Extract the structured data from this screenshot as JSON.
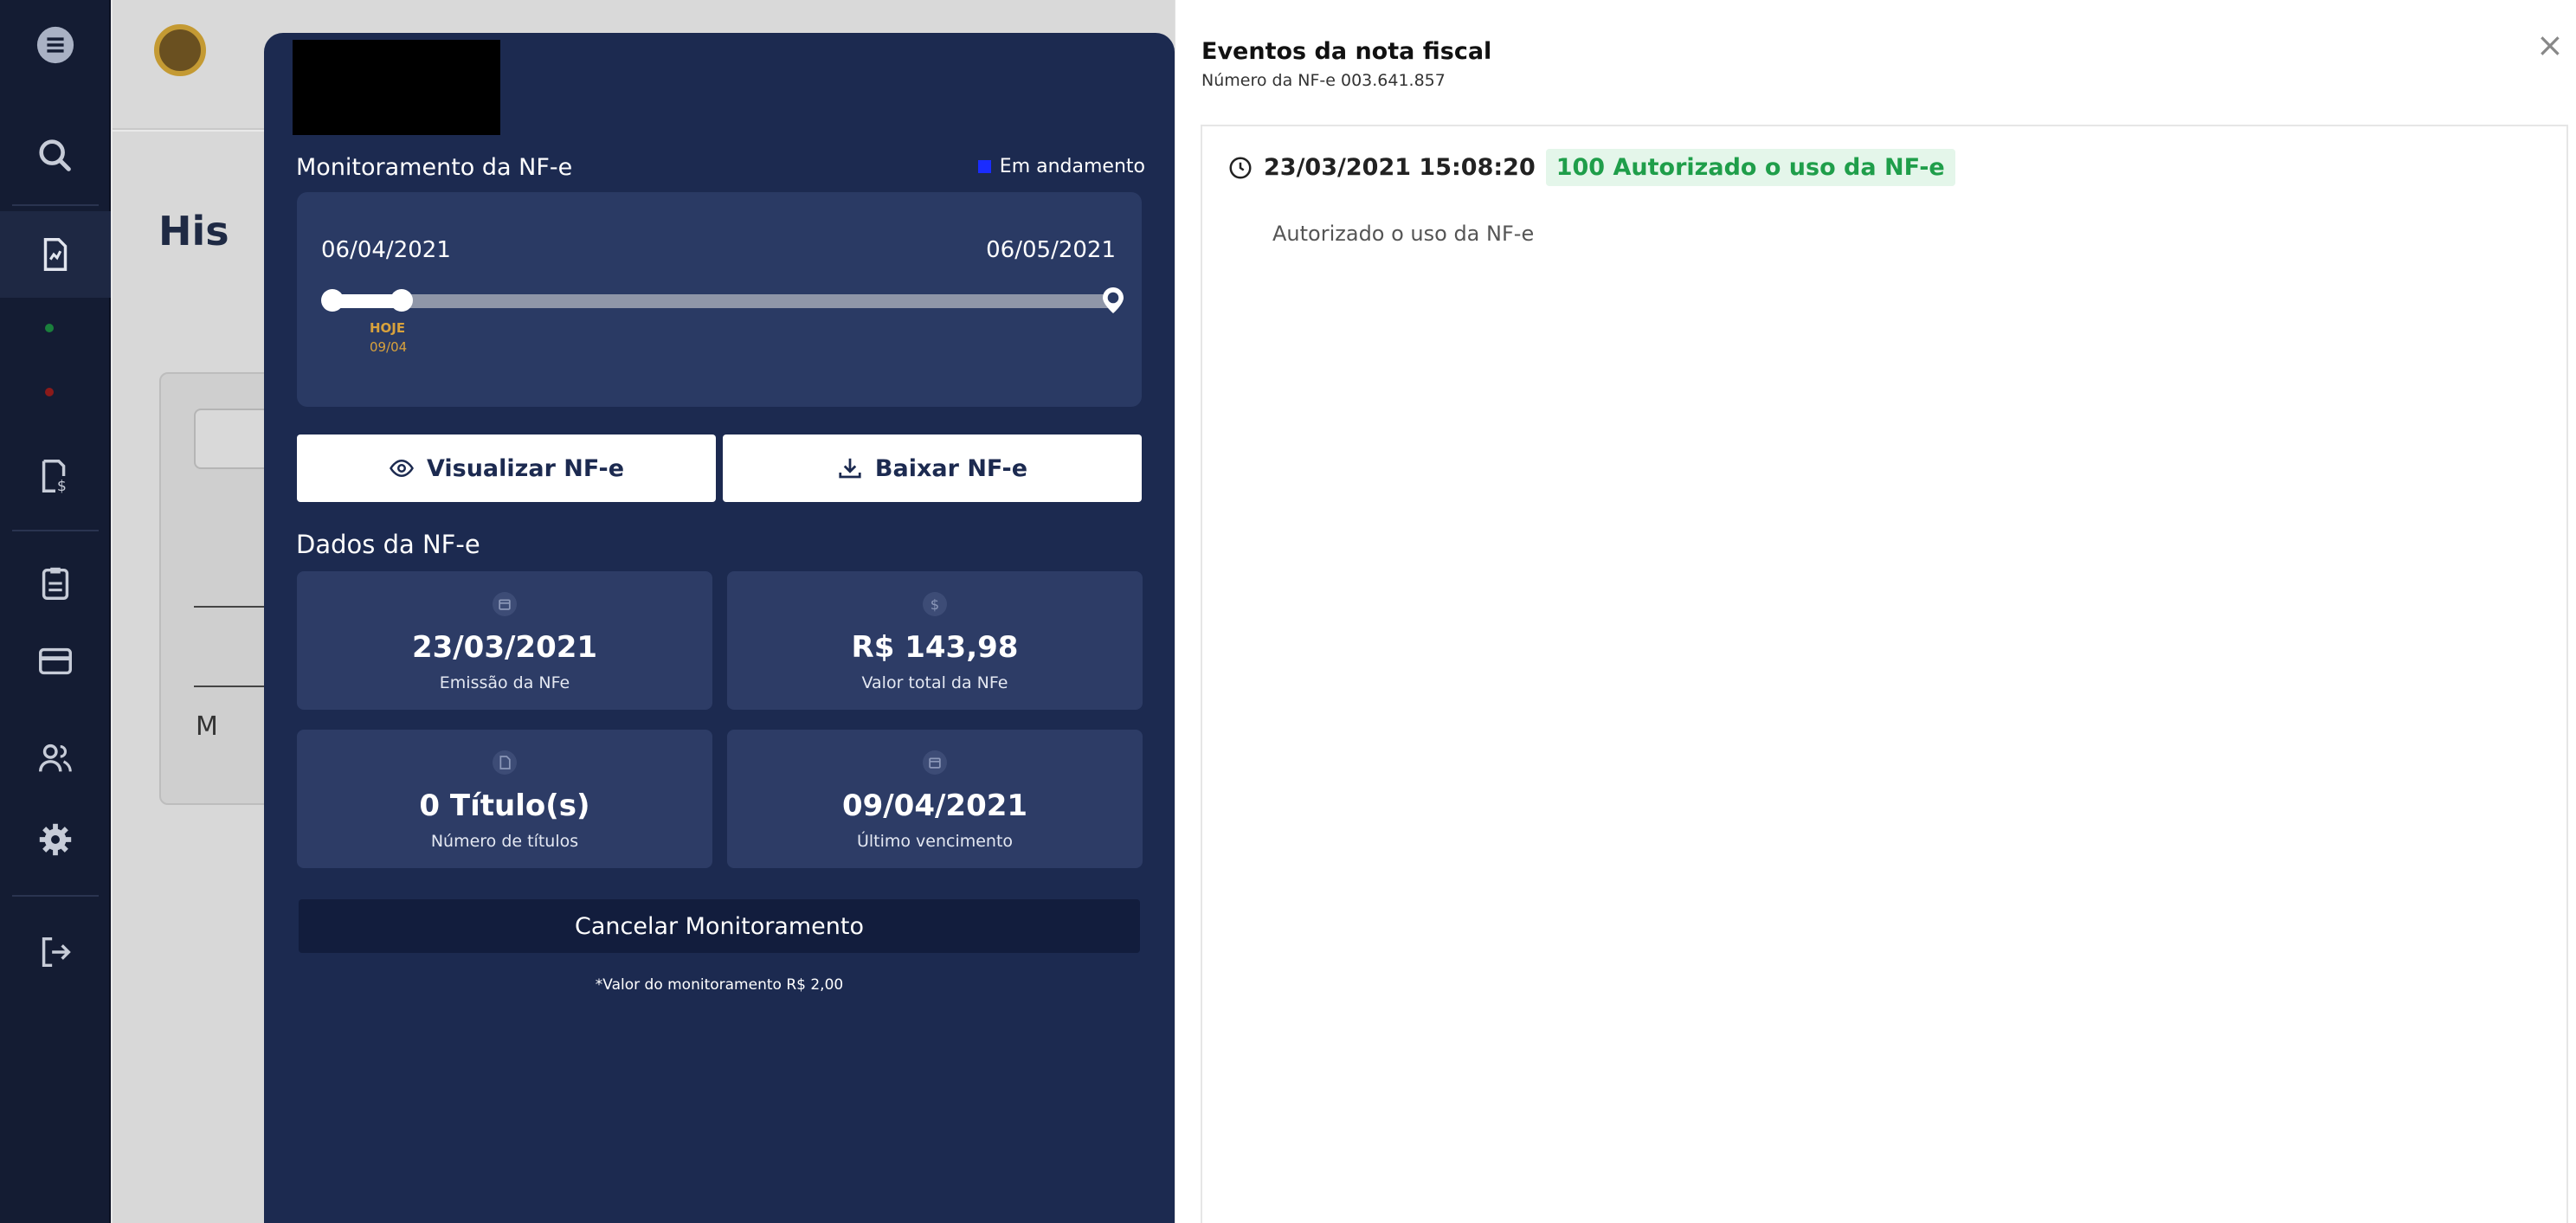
{
  "background": {
    "page_title_fragment": "His",
    "card_letter": "M"
  },
  "nav": {
    "icons": [
      "menu-icon",
      "search-icon",
      "document-icon",
      "invoice-icon",
      "clipboard-icon",
      "card-icon",
      "users-icon",
      "gear-icon",
      "logout-icon"
    ],
    "status_dots": [
      "#1a7f3c",
      "#8b1a1a"
    ]
  },
  "monitor": {
    "title": "Monitoramento da NF-e",
    "status_label": "Em andamento",
    "status_color": "#1a2cff",
    "start_date": "06/04/2021",
    "end_date": "06/05/2021",
    "today_label": "HOJE",
    "today_date": "09/04",
    "progress_fraction": 0.09,
    "view_button": "Visualizar NF-e",
    "download_button": "Baixar NF-e",
    "dados_title": "Dados da NF-e",
    "stats": [
      {
        "icon": "calendar-icon",
        "value": "23/03/2021",
        "label": "Emissão da NFe"
      },
      {
        "icon": "dollar-icon",
        "value": "R$ 143,98",
        "label": "Valor total da NFe"
      },
      {
        "icon": "file-icon",
        "value": "0 Título(s)",
        "label": "Número de títulos"
      },
      {
        "icon": "calendar-icon",
        "value": "09/04/2021",
        "label": "Último vencimento"
      }
    ],
    "cancel_button": "Cancelar Monitoramento",
    "note": "*Valor do monitoramento R$ 2,00"
  },
  "events": {
    "title": "Eventos da nota fiscal",
    "subtitle": "Número da NF-e 003.641.857",
    "close": "×",
    "items": [
      {
        "timestamp": "23/03/2021 15:08:20",
        "tag": "100 Autorizado o uso da NF-e",
        "description": "Autorizado o uso da NF-e"
      }
    ]
  },
  "colors": {
    "panel": "#1c2a50",
    "tag_bg": "#e4f6ea",
    "tag_text": "#1f9e4a",
    "today": "#d9a23c"
  }
}
